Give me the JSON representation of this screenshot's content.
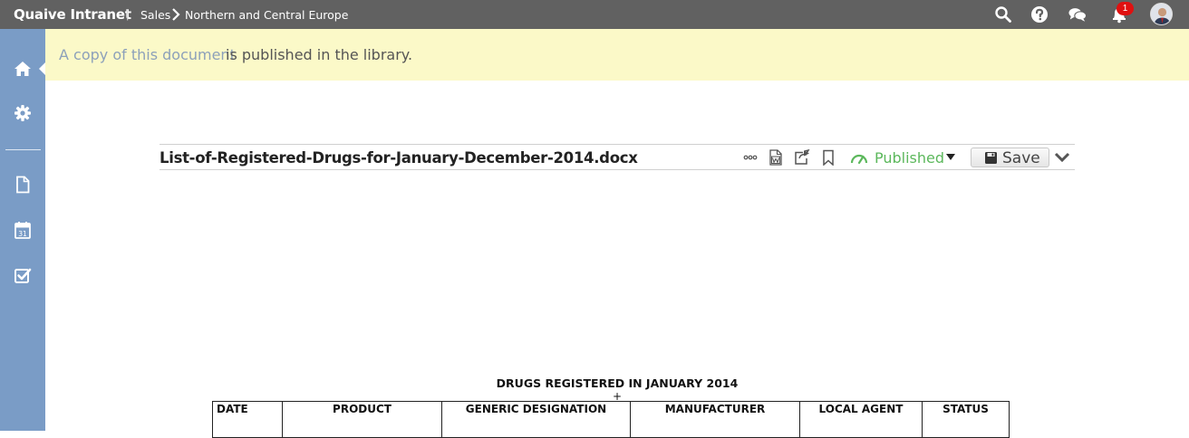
{
  "header": {
    "app_title": "Quaive Intranet",
    "separator": "|",
    "breadcrumb": [
      "Sales",
      "Northern and Central Europe"
    ],
    "notifications_count": "1",
    "icons": [
      "search-icon",
      "help-icon",
      "chat-icon",
      "bell-icon",
      "avatar"
    ]
  },
  "sidebar": {
    "items": [
      {
        "icon": "home-icon",
        "active": true
      },
      {
        "icon": "gear-icon"
      },
      {
        "icon": "document-icon"
      },
      {
        "icon": "calendar-icon",
        "label": "31"
      },
      {
        "icon": "checkbox-icon"
      }
    ]
  },
  "notice": {
    "link_text": "A copy of this document",
    "text": "is published in the library."
  },
  "document": {
    "filename": "List-of-Registered-Drugs-for-January-December-2014.docx",
    "status_label": "Published",
    "save_label": "Save",
    "toolbar_icons": [
      "more-icon",
      "word-icon",
      "share-icon",
      "bookmark-icon",
      "published-gauge-icon",
      "save-icon",
      "chevron-down-icon"
    ]
  },
  "page": {
    "heading": "DRUGS REGISTERED IN JANUARY 2014",
    "marker": "+",
    "table_headers": [
      "DATE",
      "PRODUCT",
      "GENERIC DESIGNATION",
      "MANUFACTURER",
      "LOCAL AGENT",
      "STATUS"
    ]
  },
  "colors": {
    "topbar": "#616161",
    "sidebar": "#7a9cc6",
    "notice_bg": "#fbf9c8",
    "notice_link": "#8da1ba",
    "published": "#5cb85c",
    "badge": "#e01010"
  }
}
